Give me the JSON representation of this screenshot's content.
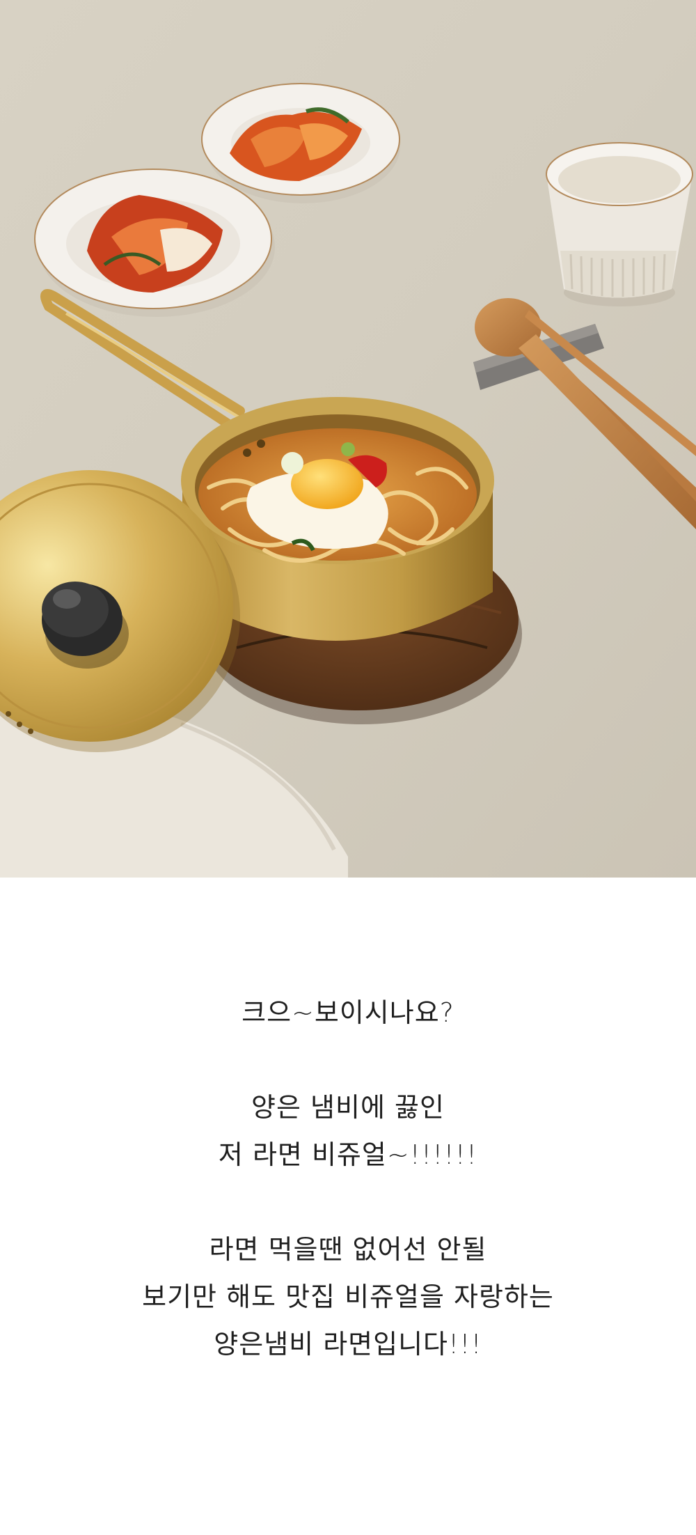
{
  "product_photo": {
    "alt": "양은냄비 라면"
  },
  "copy": {
    "paragraphs": [
      [
        "크으~보이시나요?"
      ],
      [
        "양은 냄비에 끓인",
        "저 라면 비쥬얼~!!!!!!"
      ],
      [
        "라면 먹을땐 없어선 안될",
        "보기만 해도 맛집 비쥬얼을 자랑하는",
        "양은냄비 라면입니다!!!"
      ]
    ]
  }
}
